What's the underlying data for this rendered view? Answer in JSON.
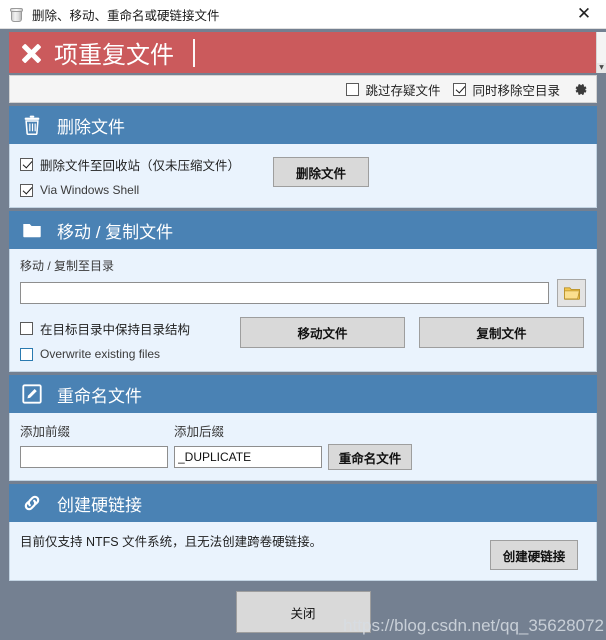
{
  "window": {
    "title": "删除、移动、重命名或硬链接文件",
    "icon": "recycle-bin-icon",
    "close_label": "✕"
  },
  "banner": {
    "icon": "x-mark-icon",
    "title": "项重复文件",
    "scroll_arrow": "▼",
    "background_color": "#cb5a5c"
  },
  "options": {
    "skip_suspect": {
      "label": "跳过存疑文件",
      "checked": false
    },
    "remove_empty_dirs": {
      "label": "同时移除空目录",
      "checked": true
    },
    "settings_icon": "gear-icon"
  },
  "sections": {
    "delete": {
      "icon": "trash-can-icon",
      "title": "删除文件",
      "checkboxes": [
        {
          "label": "删除文件至回收站（仅未压缩文件）",
          "checked": true
        },
        {
          "label": "Via Windows Shell",
          "checked": true
        }
      ],
      "button": "删除文件"
    },
    "move": {
      "icon": "folder-icon",
      "title": "移动 / 复制文件",
      "field_label": "移动 / 复制至目录",
      "path_value": "",
      "path_placeholder": "",
      "browse_icon": "open-folder-icon",
      "checkboxes": [
        {
          "label": "在目标目录中保持目录结构",
          "checked": false
        },
        {
          "label": "Overwrite existing files",
          "checked": false
        }
      ],
      "move_button": "移动文件",
      "copy_button": "复制文件"
    },
    "rename": {
      "icon": "pencil-edit-icon",
      "title": "重命名文件",
      "prefix_label": "添加前缀",
      "suffix_label": "添加后缀",
      "prefix_value": "",
      "suffix_value": "_DUPLICATE",
      "button": "重命名文件"
    },
    "hardlink": {
      "icon": "chain-link-icon",
      "title": "创建硬链接",
      "note": "目前仅支持 NTFS 文件系统，且无法创建跨卷硬链接。",
      "button": "创建硬链接"
    }
  },
  "footer": {
    "close_button": "关闭",
    "watermark": "https://blog.csdn.net/qq_35628072"
  },
  "colors": {
    "banner_red": "#cb5a5c",
    "header_blue": "#4a82b4",
    "panel_bg": "#eaf3fd",
    "window_bg": "#748091"
  }
}
